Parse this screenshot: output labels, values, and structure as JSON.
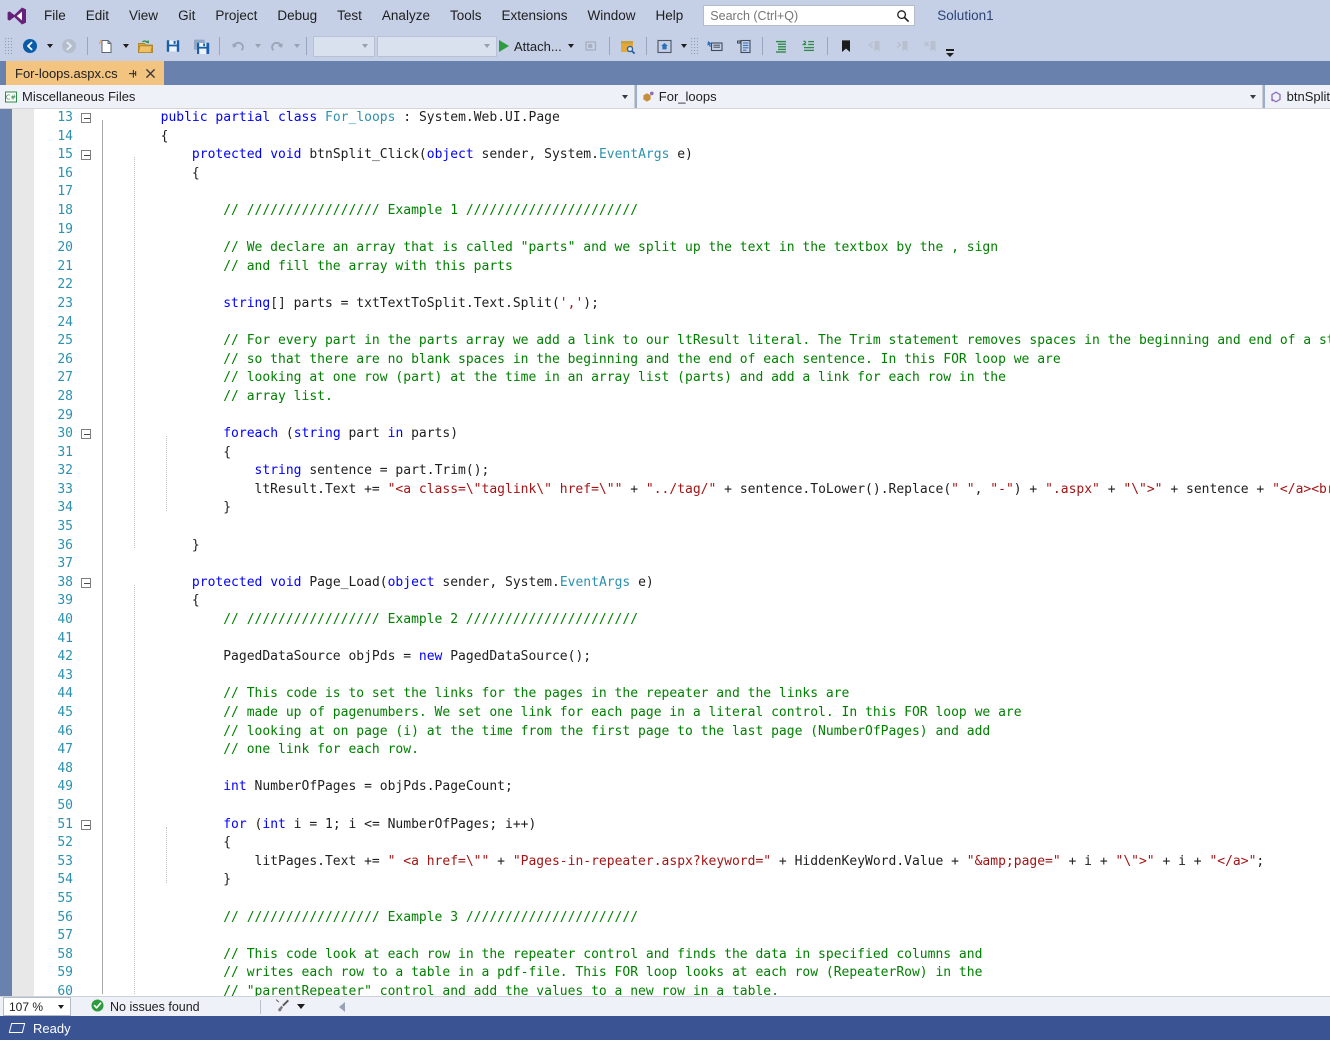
{
  "window": {
    "solution_name": "Solution1"
  },
  "menubar": {
    "logo_icon": "visual-studio-logo",
    "items": [
      {
        "label": "File"
      },
      {
        "label": "Edit"
      },
      {
        "label": "View"
      },
      {
        "label": "Git"
      },
      {
        "label": "Project"
      },
      {
        "label": "Debug"
      },
      {
        "label": "Test"
      },
      {
        "label": "Analyze"
      },
      {
        "label": "Tools"
      },
      {
        "label": "Extensions"
      },
      {
        "label": "Window"
      },
      {
        "label": "Help"
      }
    ],
    "search": {
      "placeholder": "Search (Ctrl+Q)",
      "icon": "search-icon"
    }
  },
  "toolbar": {
    "attach_label": "Attach...",
    "icons": [
      "navigate-backward-icon",
      "navigate-forward-icon",
      "new-file-icon",
      "open-file-icon",
      "save-icon",
      "save-all-icon",
      "undo-icon",
      "redo-icon",
      "start-debug-icon",
      "step-icon",
      "find-in-files-icon",
      "solution-explorer-icon",
      "properties-icon",
      "object-browser-icon",
      "indent-icon",
      "outdent-icon",
      "bookmark-icon",
      "prev-bookmark-icon",
      "next-bookmark-icon",
      "clear-bookmark-icon"
    ]
  },
  "tabs": [
    {
      "label": "For-loops.aspx.cs",
      "active": true,
      "pin_icon": "pin-icon",
      "close_icon": "close-icon"
    }
  ],
  "navbar": {
    "project": {
      "text": "Miscellaneous Files",
      "icon": "csharp-file-icon"
    },
    "type": {
      "text": "For_loops",
      "icon": "class-icon"
    },
    "member": {
      "text": "btnSplit",
      "icon": "method-icon"
    }
  },
  "editor": {
    "first_line": 13,
    "lines": [
      {
        "n": 13,
        "fold": "minus",
        "tokens": [
          {
            "t": "        ",
            "c": "pl"
          },
          {
            "t": "public",
            "c": "kw"
          },
          {
            "t": " ",
            "c": "pl"
          },
          {
            "t": "partial",
            "c": "kw"
          },
          {
            "t": " ",
            "c": "pl"
          },
          {
            "t": "class",
            "c": "kw"
          },
          {
            "t": " ",
            "c": "pl"
          },
          {
            "t": "For_loops",
            "c": "ty"
          },
          {
            "t": " : System.Web.UI.Page",
            "c": "pl"
          }
        ]
      },
      {
        "n": 14,
        "fold": "none",
        "tokens": [
          {
            "t": "        {",
            "c": "pl"
          }
        ]
      },
      {
        "n": 15,
        "fold": "minus",
        "tokens": [
          {
            "t": "            ",
            "c": "pl"
          },
          {
            "t": "protected",
            "c": "kw"
          },
          {
            "t": " ",
            "c": "pl"
          },
          {
            "t": "void",
            "c": "kw"
          },
          {
            "t": " btnSplit_Click(",
            "c": "pl"
          },
          {
            "t": "object",
            "c": "kw"
          },
          {
            "t": " sender, System.",
            "c": "pl"
          },
          {
            "t": "EventArgs",
            "c": "ty"
          },
          {
            "t": " e)",
            "c": "pl"
          }
        ]
      },
      {
        "n": 16,
        "fold": "none",
        "tokens": [
          {
            "t": "            {",
            "c": "pl"
          }
        ]
      },
      {
        "n": 17,
        "fold": "none",
        "tokens": []
      },
      {
        "n": 18,
        "fold": "none",
        "tokens": [
          {
            "t": "                // ///////////////// Example 1 //////////////////////",
            "c": "cm"
          }
        ]
      },
      {
        "n": 19,
        "fold": "none",
        "tokens": []
      },
      {
        "n": 20,
        "fold": "none",
        "tokens": [
          {
            "t": "                // We declare an array that is called \"parts\" and we split up the text in the textbox by the , sign",
            "c": "cm"
          }
        ]
      },
      {
        "n": 21,
        "fold": "none",
        "tokens": [
          {
            "t": "                // and fill the array with this parts",
            "c": "cm"
          }
        ]
      },
      {
        "n": 22,
        "fold": "none",
        "tokens": []
      },
      {
        "n": 23,
        "fold": "none",
        "tokens": [
          {
            "t": "                ",
            "c": "pl"
          },
          {
            "t": "string",
            "c": "kw"
          },
          {
            "t": "[] parts = txtTextToSplit.Text.Split(",
            "c": "pl"
          },
          {
            "t": "','",
            "c": "st"
          },
          {
            "t": ");",
            "c": "pl"
          }
        ]
      },
      {
        "n": 24,
        "fold": "none",
        "tokens": []
      },
      {
        "n": 25,
        "fold": "none",
        "tokens": [
          {
            "t": "                // For every part in the parts array we add a link to our ltResult literal. The Trim statement removes spaces in the beginning and end of a string",
            "c": "cm"
          }
        ]
      },
      {
        "n": 26,
        "fold": "none",
        "tokens": [
          {
            "t": "                // so that there are no blank spaces in the beginning and the end of each sentence. In this FOR loop we are",
            "c": "cm"
          }
        ]
      },
      {
        "n": 27,
        "fold": "none",
        "tokens": [
          {
            "t": "                // looking at one row (part) at the time in an array list (parts) and add a link for each row in the",
            "c": "cm"
          }
        ]
      },
      {
        "n": 28,
        "fold": "none",
        "tokens": [
          {
            "t": "                // array list.",
            "c": "cm"
          }
        ]
      },
      {
        "n": 29,
        "fold": "none",
        "tokens": []
      },
      {
        "n": 30,
        "fold": "minus",
        "tokens": [
          {
            "t": "                ",
            "c": "pl"
          },
          {
            "t": "foreach",
            "c": "kw"
          },
          {
            "t": " (",
            "c": "pl"
          },
          {
            "t": "string",
            "c": "kw"
          },
          {
            "t": " part ",
            "c": "pl"
          },
          {
            "t": "in",
            "c": "kw"
          },
          {
            "t": " parts)",
            "c": "pl"
          }
        ]
      },
      {
        "n": 31,
        "fold": "none",
        "tokens": [
          {
            "t": "                {",
            "c": "pl"
          }
        ]
      },
      {
        "n": 32,
        "fold": "none",
        "tokens": [
          {
            "t": "                    ",
            "c": "pl"
          },
          {
            "t": "string",
            "c": "kw"
          },
          {
            "t": " sentence = part.Trim();",
            "c": "pl"
          }
        ]
      },
      {
        "n": 33,
        "fold": "none",
        "tokens": [
          {
            "t": "                    ltResult.Text += ",
            "c": "pl"
          },
          {
            "t": "\"<a class=\\\"taglink\\\" href=\\\"\"",
            "c": "st"
          },
          {
            "t": " + ",
            "c": "pl"
          },
          {
            "t": "\"../tag/\"",
            "c": "st"
          },
          {
            "t": " + sentence.ToLower().Replace(",
            "c": "pl"
          },
          {
            "t": "\" \"",
            "c": "st"
          },
          {
            "t": ", ",
            "c": "pl"
          },
          {
            "t": "\"-\"",
            "c": "st"
          },
          {
            "t": ") + ",
            "c": "pl"
          },
          {
            "t": "\".aspx\"",
            "c": "st"
          },
          {
            "t": " + ",
            "c": "pl"
          },
          {
            "t": "\"\\\">\"",
            "c": "st"
          },
          {
            "t": " + sentence + ",
            "c": "pl"
          },
          {
            "t": "\"</a><br />\"",
            "c": "st"
          },
          {
            "t": ";",
            "c": "pl"
          }
        ]
      },
      {
        "n": 34,
        "fold": "none",
        "tokens": [
          {
            "t": "                }",
            "c": "pl"
          }
        ]
      },
      {
        "n": 35,
        "fold": "none",
        "tokens": []
      },
      {
        "n": 36,
        "fold": "none",
        "tokens": [
          {
            "t": "            }",
            "c": "pl"
          }
        ]
      },
      {
        "n": 37,
        "fold": "none",
        "tokens": []
      },
      {
        "n": 38,
        "fold": "minus",
        "tokens": [
          {
            "t": "            ",
            "c": "pl"
          },
          {
            "t": "protected",
            "c": "kw"
          },
          {
            "t": " ",
            "c": "pl"
          },
          {
            "t": "void",
            "c": "kw"
          },
          {
            "t": " Page_Load(",
            "c": "pl"
          },
          {
            "t": "object",
            "c": "kw"
          },
          {
            "t": " sender, System.",
            "c": "pl"
          },
          {
            "t": "EventArgs",
            "c": "ty"
          },
          {
            "t": " e)",
            "c": "pl"
          }
        ]
      },
      {
        "n": 39,
        "fold": "none",
        "tokens": [
          {
            "t": "            {",
            "c": "pl"
          }
        ]
      },
      {
        "n": 40,
        "fold": "none",
        "tokens": [
          {
            "t": "                // ///////////////// Example 2 //////////////////////",
            "c": "cm"
          }
        ]
      },
      {
        "n": 41,
        "fold": "none",
        "tokens": []
      },
      {
        "n": 42,
        "fold": "none",
        "tokens": [
          {
            "t": "                PagedDataSource objPds = ",
            "c": "pl"
          },
          {
            "t": "new",
            "c": "kw"
          },
          {
            "t": " PagedDataSource();",
            "c": "pl"
          }
        ]
      },
      {
        "n": 43,
        "fold": "none",
        "tokens": []
      },
      {
        "n": 44,
        "fold": "none",
        "tokens": [
          {
            "t": "                // This code is to set the links for the pages in the repeater and the links are",
            "c": "cm"
          }
        ]
      },
      {
        "n": 45,
        "fold": "none",
        "tokens": [
          {
            "t": "                // made up of pagenumbers. We set one link for each page in a literal control. In this FOR loop we are",
            "c": "cm"
          }
        ]
      },
      {
        "n": 46,
        "fold": "none",
        "tokens": [
          {
            "t": "                // looking at on page (i) at the time from the first page to the last page (NumberOfPages) and add",
            "c": "cm"
          }
        ]
      },
      {
        "n": 47,
        "fold": "none",
        "tokens": [
          {
            "t": "                // one link for each row.",
            "c": "cm"
          }
        ]
      },
      {
        "n": 48,
        "fold": "none",
        "tokens": []
      },
      {
        "n": 49,
        "fold": "none",
        "tokens": [
          {
            "t": "                ",
            "c": "pl"
          },
          {
            "t": "int",
            "c": "kw"
          },
          {
            "t": " NumberOfPages = objPds.PageCount;",
            "c": "pl"
          }
        ]
      },
      {
        "n": 50,
        "fold": "none",
        "tokens": []
      },
      {
        "n": 51,
        "fold": "minus",
        "tokens": [
          {
            "t": "                ",
            "c": "pl"
          },
          {
            "t": "for",
            "c": "kw"
          },
          {
            "t": " (",
            "c": "pl"
          },
          {
            "t": "int",
            "c": "kw"
          },
          {
            "t": " i = 1; i <= NumberOfPages; i++)",
            "c": "pl"
          }
        ]
      },
      {
        "n": 52,
        "fold": "none",
        "tokens": [
          {
            "t": "                {",
            "c": "pl"
          }
        ]
      },
      {
        "n": 53,
        "fold": "none",
        "tokens": [
          {
            "t": "                    litPages.Text += ",
            "c": "pl"
          },
          {
            "t": "\" <a href=\\\"\"",
            "c": "st"
          },
          {
            "t": " + ",
            "c": "pl"
          },
          {
            "t": "\"Pages-in-repeater.aspx?keyword=\"",
            "c": "st"
          },
          {
            "t": " + HiddenKeyWord.Value + ",
            "c": "pl"
          },
          {
            "t": "\"&amp;page=\"",
            "c": "st"
          },
          {
            "t": " + i + ",
            "c": "pl"
          },
          {
            "t": "\"\\\">\"",
            "c": "st"
          },
          {
            "t": " + i + ",
            "c": "pl"
          },
          {
            "t": "\"</a>\"",
            "c": "st"
          },
          {
            "t": ";",
            "c": "pl"
          }
        ]
      },
      {
        "n": 54,
        "fold": "none",
        "tokens": [
          {
            "t": "                }",
            "c": "pl"
          }
        ]
      },
      {
        "n": 55,
        "fold": "none",
        "tokens": []
      },
      {
        "n": 56,
        "fold": "none",
        "tokens": [
          {
            "t": "                // ///////////////// Example 3 //////////////////////",
            "c": "cm"
          }
        ]
      },
      {
        "n": 57,
        "fold": "none",
        "tokens": []
      },
      {
        "n": 58,
        "fold": "none",
        "tokens": [
          {
            "t": "                // This code look at each row in the repeater control and finds the data in specified columns and",
            "c": "cm"
          }
        ]
      },
      {
        "n": 59,
        "fold": "none",
        "tokens": [
          {
            "t": "                // writes each row to a table in a pdf-file. This FOR loop looks at each row (RepeaterRow) in the",
            "c": "cm"
          }
        ]
      },
      {
        "n": 60,
        "fold": "none",
        "tokens": [
          {
            "t": "                // \"parentRepeater\" control and add the values to a new row in a table.",
            "c": "cm"
          }
        ]
      }
    ]
  },
  "editor_status": {
    "zoom": "107 %",
    "issues_label": "No issues found",
    "issues_icon": "check-circle-icon",
    "brush_icon": "brush-icon",
    "prev_icon": "prev-arrow-icon"
  },
  "statusbar": {
    "text": "Ready",
    "glyph": "ready-glyph"
  },
  "colors": {
    "chrome": "#c5cfe5",
    "tabstrip": "#6982ad",
    "active_tab": "#f2c480",
    "statusbar": "#3a5493",
    "keyword": "#0000ff",
    "type": "#2b91af",
    "comment": "#008000",
    "string": "#a31515",
    "linenumber": "#2b91af"
  }
}
